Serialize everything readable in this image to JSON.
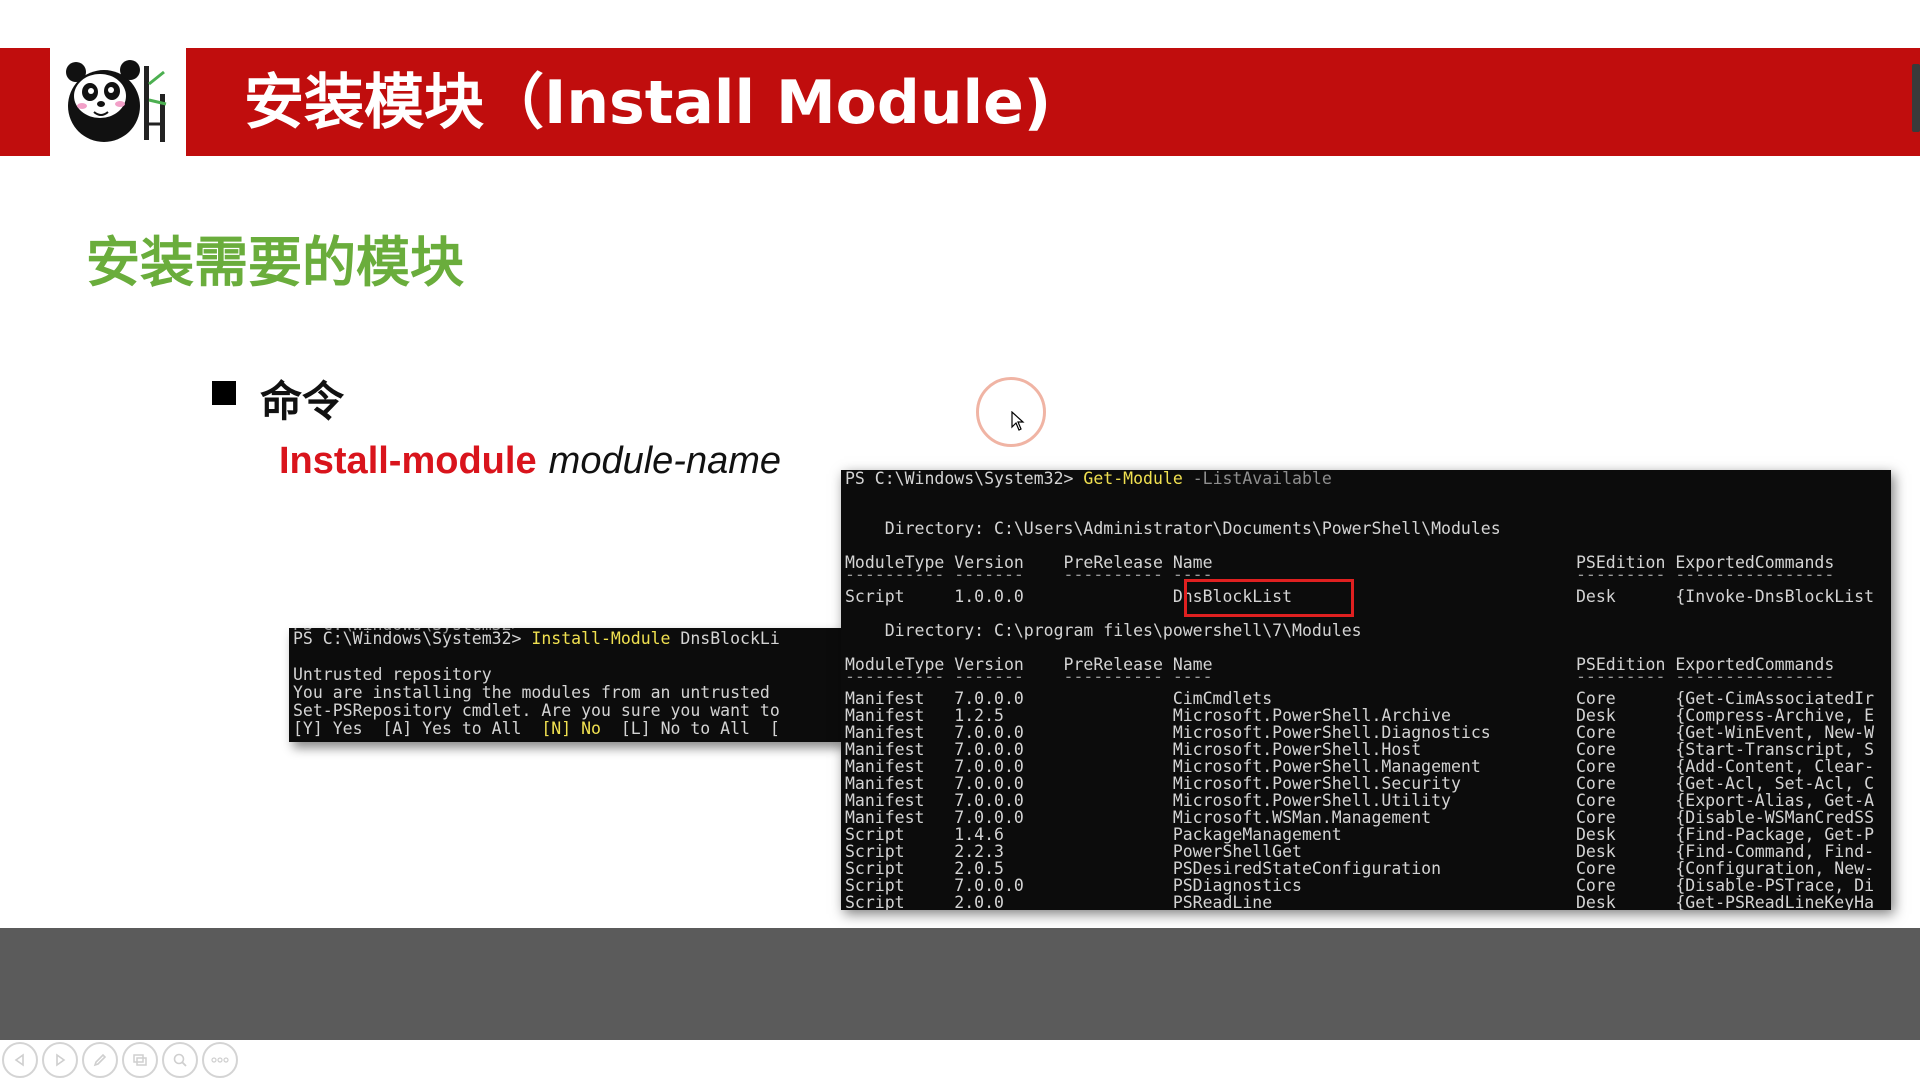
{
  "slide": {
    "title": "安装模块（Install Module)",
    "subtitle": "安装需要的模块",
    "bullet_label": "命令",
    "command_name": "Install-module",
    "command_arg": "module-name"
  },
  "terminal_small": {
    "lines": [
      {
        "prompt": "PS C:\\Windows\\System32> ",
        "cmd": "Install-Module",
        "rest": " DnsBlockLi"
      },
      {
        "text": ""
      },
      {
        "text": "Untrusted repository"
      },
      {
        "text": "You are installing the modules from an untrusted"
      },
      {
        "text": "Set-PSRepository cmdlet. Are you sure you want to"
      },
      {
        "choices": "[Y] Yes  [A] Yes to All  ",
        "default": "[N] No",
        "after": "  [L] No to All  ["
      }
    ]
  },
  "terminal_large": {
    "prompt": "PS C:\\Windows\\System32> ",
    "command": "Get-Module",
    "param": " -ListAvailable",
    "directory1": "    Directory: C:\\Users\\Administrator\\Documents\\PowerShell\\Modules",
    "directory2": "    Directory: C:\\program files\\powershell\\7\\Modules",
    "header_left": "ModuleType Version    PreRelease Name",
    "header_right": "PSEdition ExportedCommands",
    "separator_left": "---------- -------    ---------- ----",
    "separator_right": "--------- ----------------",
    "highlighted_row": {
      "left": "Script     1.0.0.0               DnsBlockList",
      "right": "Desk      {Invoke-DnsBlockList"
    },
    "modules": [
      {
        "left": "Manifest   7.0.0.0               CimCmdlets",
        "right": "Core      {Get-CimAssociatedIr"
      },
      {
        "left": "Manifest   1.2.5                 Microsoft.PowerShell.Archive",
        "right": "Desk      {Compress-Archive, E"
      },
      {
        "left": "Manifest   7.0.0.0               Microsoft.PowerShell.Diagnostics",
        "right": "Core      {Get-WinEvent, New-W"
      },
      {
        "left": "Manifest   7.0.0.0               Microsoft.PowerShell.Host",
        "right": "Core      {Start-Transcript, S"
      },
      {
        "left": "Manifest   7.0.0.0               Microsoft.PowerShell.Management",
        "right": "Core      {Add-Content, Clear-"
      },
      {
        "left": "Manifest   7.0.0.0               Microsoft.PowerShell.Security",
        "right": "Core      {Get-Acl, Set-Acl, C"
      },
      {
        "left": "Manifest   7.0.0.0               Microsoft.PowerShell.Utility",
        "right": "Core      {Export-Alias, Get-A"
      },
      {
        "left": "Manifest   7.0.0.0               Microsoft.WSMan.Management",
        "right": "Core      {Disable-WSManCredSS"
      },
      {
        "left": "Script     1.4.6                 PackageManagement",
        "right": "Desk      {Find-Package, Get-P"
      },
      {
        "left": "Script     2.2.3                 PowerShellGet",
        "right": "Desk      {Find-Command, Find-"
      },
      {
        "left": "Script     2.0.5                 PSDesiredStateConfiguration",
        "right": "Core      {Configuration, New-"
      },
      {
        "left": "Script     7.0.0.0               PSDiagnostics",
        "right": "Core      {Disable-PSTrace, Di"
      },
      {
        "left": "Script     2.0.0                 PSReadLine",
        "right": "Desk      {Get-PSReadLineKeyHa"
      }
    ]
  },
  "toolbar": {
    "buttons": [
      "previous-icon",
      "next-icon",
      "pen-icon",
      "slides-icon",
      "zoom-icon",
      "more-icon"
    ]
  },
  "colors": {
    "header_red": "#c00d0d",
    "subtitle_green": "#6aad3c",
    "command_red": "#d9141c",
    "terminal_bg": "#0c0c0c",
    "terminal_yellow": "#f0e050"
  }
}
